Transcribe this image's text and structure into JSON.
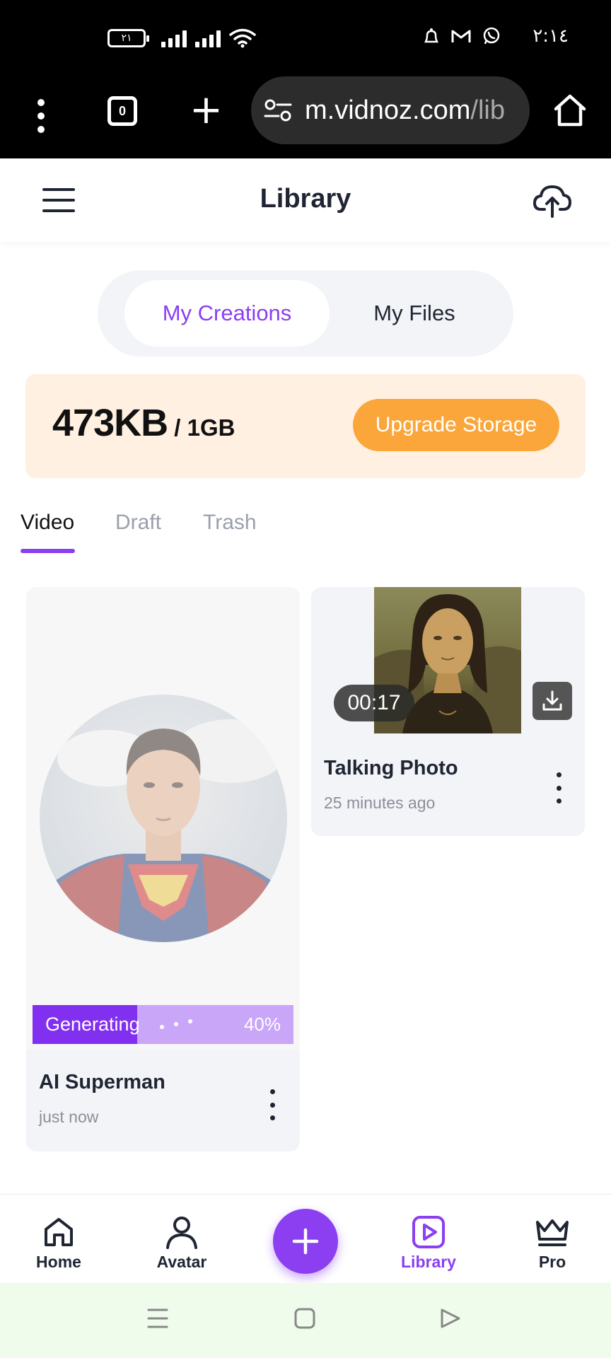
{
  "status_bar": {
    "battery_level": "٢١",
    "clock": "٢:١٤",
    "icons": [
      "signal-icon",
      "wifi-icon",
      "alarm-icon",
      "gmail-icon",
      "whatsapp-icon"
    ]
  },
  "browser": {
    "tab_count": "0",
    "url_main": "m.vidnoz.com",
    "url_rest": "/lib"
  },
  "header": {
    "title": "Library"
  },
  "segment": {
    "active": "My Creations",
    "other": "My Files"
  },
  "storage": {
    "used": "473KB",
    "total": " / 1GB",
    "upgrade_label": "Upgrade Storage"
  },
  "sub_tabs": [
    {
      "label": "Video",
      "active": true
    },
    {
      "label": "Draft",
      "active": false
    },
    {
      "label": "Trash",
      "active": false
    }
  ],
  "cards": [
    {
      "title": "AI Superman",
      "subtitle": "just now",
      "status": "Generating",
      "progress_label": "40%",
      "progress": 0.4
    },
    {
      "title": "Talking Photo",
      "subtitle": "25 minutes ago",
      "duration": "00:17"
    }
  ],
  "bottom_nav": {
    "items": [
      {
        "label": "Home",
        "icon": "home-icon"
      },
      {
        "label": "Avatar",
        "icon": "person-icon"
      },
      {
        "label": "Library",
        "icon": "play-icon",
        "active": true
      },
      {
        "label": "Pro",
        "icon": "crown-icon"
      }
    ]
  },
  "colors": {
    "accent": "#8b3ff0",
    "upgrade": "#fba63a",
    "storage_bg": "#fff0e2"
  }
}
